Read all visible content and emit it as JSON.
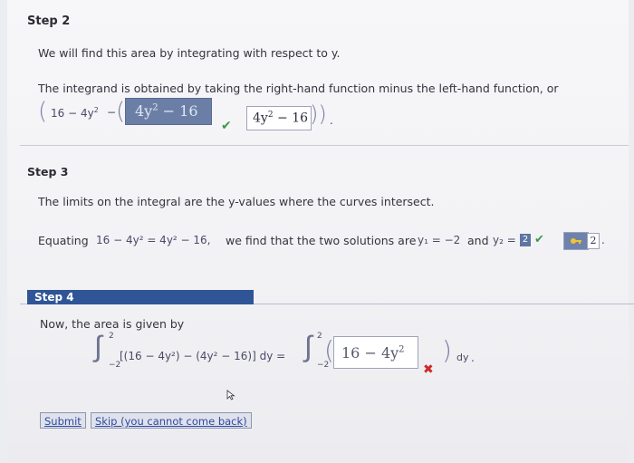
{
  "step2": {
    "title": "Step 2",
    "line1": "We will find this area by integrating with respect to y.",
    "line2": "The integrand is obtained by taking the right-hand function minus the left-hand function, or",
    "expr_prefix": "16 − 4y",
    "expr_prefix_exp": "2",
    "expr_minus": "−",
    "box1_value": "4y",
    "box1_exp": "2",
    "box1_rest": " − 16",
    "box2_value": "4y",
    "box2_exp": "2",
    "box2_rest": " − 16",
    "box1_status": "correct"
  },
  "step3": {
    "title": "Step 3",
    "line1": "The limits on the integral are the y-values where the curves intersect.",
    "line2_prefix": "Equating",
    "line2_eq": "16 − 4y² = 4y² − 16,",
    "line2_mid": "we find that the two solutions are",
    "y1": "y₁ = −2",
    "and": "and",
    "y2_label": "y₂ =",
    "y2_value": "2",
    "hint_value": "2",
    "y2_status": "correct"
  },
  "step4": {
    "title": "Step 4",
    "line1": "Now, the area is given by",
    "integral_upper": "2",
    "integral_lower": "−2",
    "integrand": "[(16 − 4y²) − (4y² − 16)] dy =",
    "rhs_upper": "2",
    "rhs_lower": "−2",
    "answer_value": "16 − 4y",
    "answer_exp": "2",
    "dy": "dy",
    "answer_status": "incorrect"
  },
  "actions": {
    "submit": "Submit",
    "skip": "Skip (you cannot come back)"
  },
  "colors": {
    "step4_bar": "#2f5597",
    "check": "#3a9a4a",
    "cross": "#cc2b2b"
  }
}
